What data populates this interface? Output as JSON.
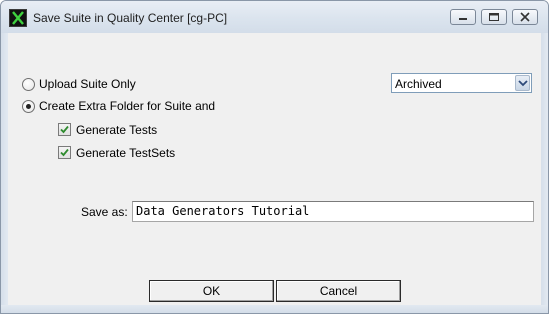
{
  "window": {
    "title": "Save Suite in Quality Center [cg-PC]",
    "controls": [
      "minimize-icon",
      "maximize-icon",
      "close-icon"
    ]
  },
  "options": {
    "upload_only_label": "Upload Suite Only",
    "upload_only_selected": false,
    "extra_folder_label": "Create Extra Folder for Suite and",
    "extra_folder_selected": true,
    "generate_tests_label": "Generate Tests",
    "generate_tests_checked": true,
    "generate_testsets_label": "Generate TestSets",
    "generate_testsets_checked": true
  },
  "status_select": {
    "value": "Archived"
  },
  "save_as": {
    "label": "Save as:",
    "value": "Data Generators Tutorial"
  },
  "buttons": {
    "ok": "OK",
    "cancel": "Cancel"
  },
  "colors": {
    "check_mark": "#2e8b2e",
    "titlebar": "#dbe4ee",
    "dialog_bg": "#f0f0f0"
  }
}
